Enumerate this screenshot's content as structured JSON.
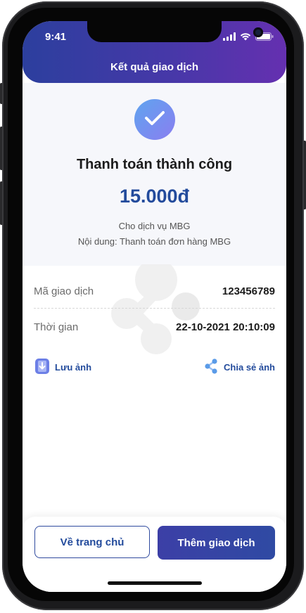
{
  "status_bar": {
    "time": "9:41"
  },
  "header": {
    "title": "Kết quả giao dịch"
  },
  "result": {
    "status_text": "Thanh toán thành công",
    "amount": "15.000đ",
    "service": "Cho dịch vụ MBG",
    "content": "Nội dung: Thanh toán đơn hàng MBG"
  },
  "details": [
    {
      "label": "Mã giao dịch",
      "value": "123456789"
    },
    {
      "label": "Thời gian",
      "value": "22-10-2021 20:10:09"
    }
  ],
  "actions": {
    "save_image": "Lưu ảnh",
    "share_image": "Chia sẻ ảnh"
  },
  "footer": {
    "home_button": "Về trang chủ",
    "add_transaction_button": "Thêm giao dịch"
  },
  "colors": {
    "primary": "#234b9c",
    "header_start": "#2c3f9e",
    "header_end": "#6530b0",
    "success_start": "#5fa4ef",
    "success_end": "#8a7ef0"
  },
  "icons": [
    "signal-icon",
    "wifi-icon",
    "battery-icon",
    "check-icon",
    "save-image-icon",
    "share-icon"
  ]
}
